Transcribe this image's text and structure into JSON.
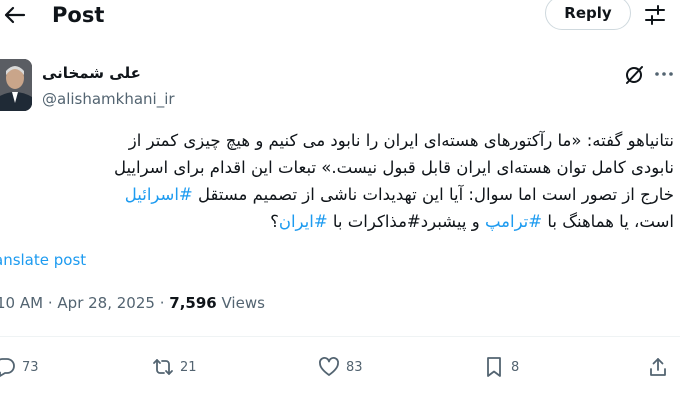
{
  "header": {
    "title": "Post",
    "reply_label": "Reply",
    "icons": [
      "back-arrow-icon",
      "settings-sliders-icon"
    ]
  },
  "author": {
    "display_name": "علی شمخانی",
    "handle": "@alishamkhani_ir"
  },
  "tweet": {
    "line1": "نتانیاهو گفته: «ما رآکتورهای هسته‌ای ایران را نابود می کنیم و هیچ چیزی کمتر از",
    "line2": "نابودی کامل توان هسته‌ای ایران قابل قبول نیست.» تبعات این اقدام برای اسراییل",
    "line3_text": "خارج از تصور است اما سوال: آیا این تهدیدات ناشی از تصمیم مستقل",
    "hashtag_israel": "#اسرائیل",
    "line4_text_a": "است، یا هماهنگ با",
    "hashtag_trump": "#ترامپ",
    "line4_text_b": "و پیشبرد#مذاکرات با",
    "hashtag_iran": "#ایران",
    "line4_end": "؟"
  },
  "translate_label": "anslate post",
  "meta": {
    "time": "10 AM",
    "separator": "·",
    "date": "Apr 28, 2025",
    "views_count": "7,596",
    "views_label": "Views"
  },
  "actions": {
    "replies": "73",
    "reposts": "21",
    "likes": "83",
    "bookmarks": "8"
  },
  "colors": {
    "link": "#1d9bf0",
    "secondary_text": "#536471",
    "primary_text": "#0f1419",
    "border": "#cfd9de"
  }
}
